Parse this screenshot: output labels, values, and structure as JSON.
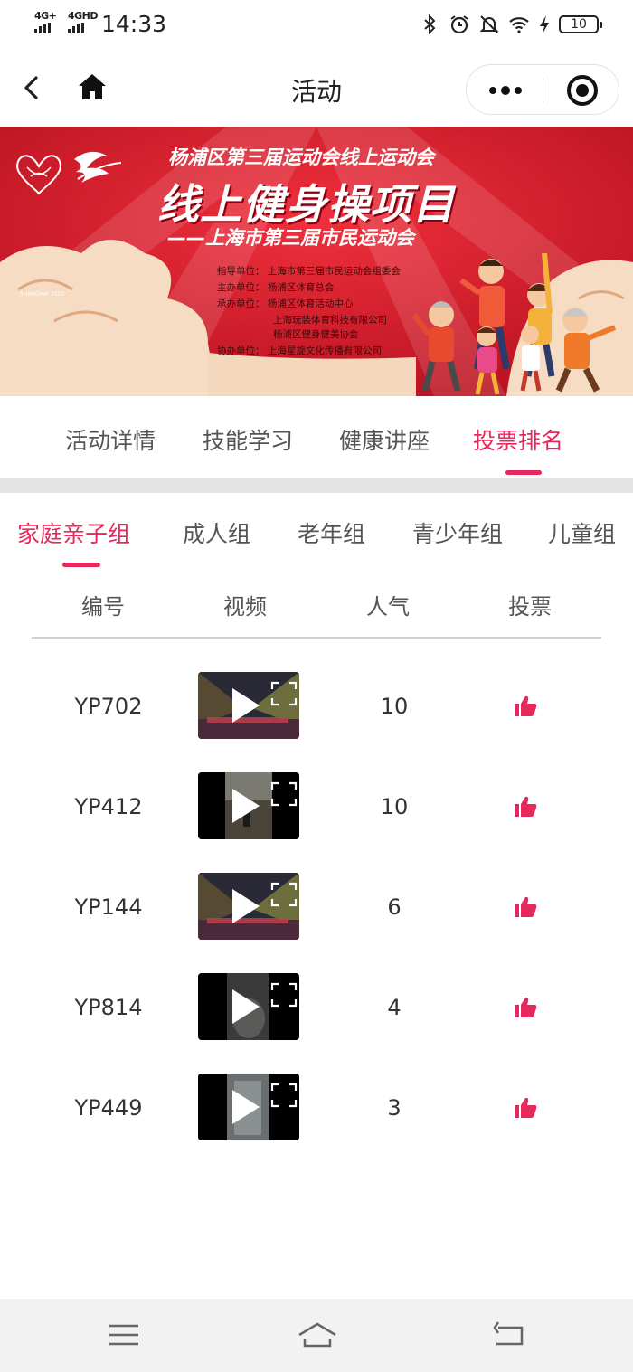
{
  "status_bar": {
    "net1": "4G+",
    "net2": "4GHD",
    "time": "14:33",
    "icons": [
      "bluetooth-icon",
      "alarm-icon",
      "mute-icon",
      "wifi-icon",
      "charging-icon"
    ],
    "battery": "10"
  },
  "nav": {
    "title": "活动",
    "icons": [
      "back-arrow-icon",
      "home-icon",
      "more-dots-icon",
      "close-target-icon"
    ]
  },
  "banner": {
    "subtitle": "杨浦区第三届运动会线上运动会",
    "title": "线上健身操项目",
    "subtitle2": "——上海市第三届市民运动会",
    "logo_text": "SHANGHAI 2020",
    "organizers": [
      "指导单位：  上海市第三届市民运动会组委会",
      "主办单位：  杨浦区体育总会",
      "承办单位：  杨浦区体育活动中心",
      "上海玩装体育科技有限公司",
      "杨浦区健身健美协会",
      "协办单位：  上海星旋文化传播有限公司"
    ]
  },
  "main_tabs": [
    {
      "label": "活动详情"
    },
    {
      "label": "技能学习"
    },
    {
      "label": "健康讲座"
    },
    {
      "label": "投票排名",
      "active": true
    }
  ],
  "group_tabs": [
    {
      "label": "家庭亲子组",
      "active": true
    },
    {
      "label": "成人组"
    },
    {
      "label": "老年组"
    },
    {
      "label": "青少年组"
    },
    {
      "label": "儿童组"
    }
  ],
  "table": {
    "headers": [
      "编号",
      "视频",
      "人气",
      "投票"
    ],
    "rows": [
      {
        "id": "YP702",
        "popularity": "10",
        "thumb": "stage"
      },
      {
        "id": "YP412",
        "popularity": "10",
        "thumb": "room"
      },
      {
        "id": "YP144",
        "popularity": "6",
        "thumb": "stage"
      },
      {
        "id": "YP814",
        "popularity": "4",
        "thumb": "dark"
      },
      {
        "id": "YP449",
        "popularity": "3",
        "thumb": "door"
      }
    ]
  },
  "colors": {
    "accent": "#e6295b",
    "banner_red": "#d81e2c",
    "divider": "#e4e4e4"
  },
  "system_bar": {
    "icons": [
      "menu-icon",
      "home-outline-icon",
      "back-return-icon"
    ]
  }
}
